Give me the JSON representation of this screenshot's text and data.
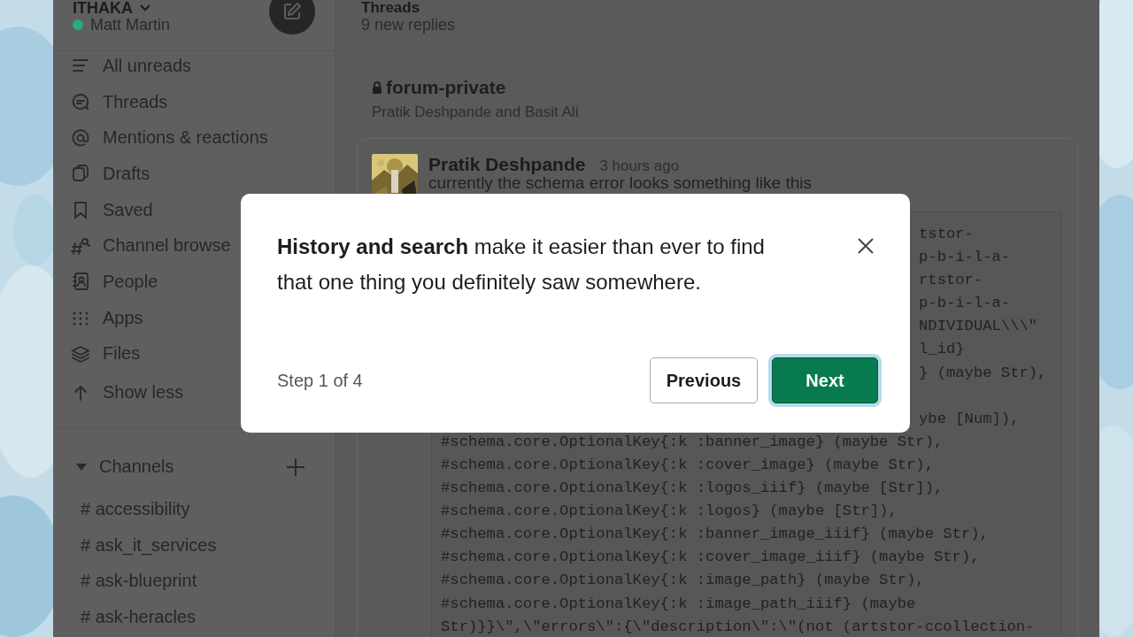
{
  "workspace": {
    "name": "ITHAKA",
    "user": "Matt Martin",
    "online": true
  },
  "nav": [
    {
      "label": "All unreads"
    },
    {
      "label": "Threads"
    },
    {
      "label": "Mentions & reactions"
    },
    {
      "label": "Drafts"
    },
    {
      "label": "Saved"
    },
    {
      "label": "Channel browse"
    },
    {
      "label": "People"
    },
    {
      "label": "Apps"
    },
    {
      "label": "Files"
    },
    {
      "label": "Show less"
    }
  ],
  "channels": {
    "title": "Channels",
    "expanded": true,
    "items": [
      {
        "sigil": "#",
        "name": "accessibility"
      },
      {
        "sigil": "#",
        "name": "ask_it_services"
      },
      {
        "sigil": "#",
        "name": "ask-blueprint"
      },
      {
        "sigil": "#",
        "name": "ask-heracles"
      }
    ]
  },
  "header": {
    "title": "Threads",
    "subtitle": "9 new replies"
  },
  "thread": {
    "channel": "forum-private",
    "private": true,
    "participants": "Pratik Deshpande and Basit Ali"
  },
  "message": {
    "author": "Pratik Deshpande",
    "time": "3 hours ago",
    "text": "currently the schema error looks something like this",
    "code": [
      {
        "kind": "fragment",
        "text": "tstor-"
      },
      {
        "kind": "fragment",
        "text": "p-b-i-l-a-"
      },
      {
        "kind": "fragment",
        "text": "rtstor-"
      },
      {
        "kind": "fragment",
        "text": "p-b-i-l-a-"
      },
      {
        "kind": "fragment",
        "text": "NDIVIDUAL\\\\\\\""
      },
      {
        "kind": "fragment",
        "text": "l_id}"
      },
      {
        "kind": "fragment",
        "text": "} (maybe Str),"
      },
      {
        "kind": "covered"
      },
      {
        "kind": "fragment",
        "text": "ybe [Num]),"
      },
      {
        "kind": "line",
        "text": "#schema.core.OptionalKey{:k :banner_image} (maybe Str),"
      },
      {
        "kind": "line",
        "text": "#schema.core.OptionalKey{:k :cover_image} (maybe Str),"
      },
      {
        "kind": "line",
        "text": "#schema.core.OptionalKey{:k :logos_iiif} (maybe [Str]),"
      },
      {
        "kind": "line",
        "text": "#schema.core.OptionalKey{:k :logos} (maybe [Str]),"
      },
      {
        "kind": "line",
        "text": "#schema.core.OptionalKey{:k :banner_image_iiif} (maybe Str),"
      },
      {
        "kind": "line",
        "text": "#schema.core.OptionalKey{:k :cover_image_iiif} (maybe Str),"
      },
      {
        "kind": "line",
        "text": "#schema.core.OptionalKey{:k :image_path} (maybe Str),"
      },
      {
        "kind": "line",
        "text": "#schema.core.OptionalKey{:k :image_path_iiif} (maybe"
      },
      {
        "kind": "line",
        "text": "Str)}}\\\",\\\"errors\\\":{\\\"description\\\":\\\"(not (artstor-ccollection-"
      }
    ]
  },
  "dialog": {
    "text": "**History and search** make it easier than ever to find that one thing you definitely saw somewhere.",
    "step": "Step 1 of 4",
    "buttons": [
      {
        "label": "Previous",
        "kind": "secondary",
        "focused": false
      },
      {
        "label": "Next",
        "kind": "primary",
        "focused": true
      }
    ]
  }
}
